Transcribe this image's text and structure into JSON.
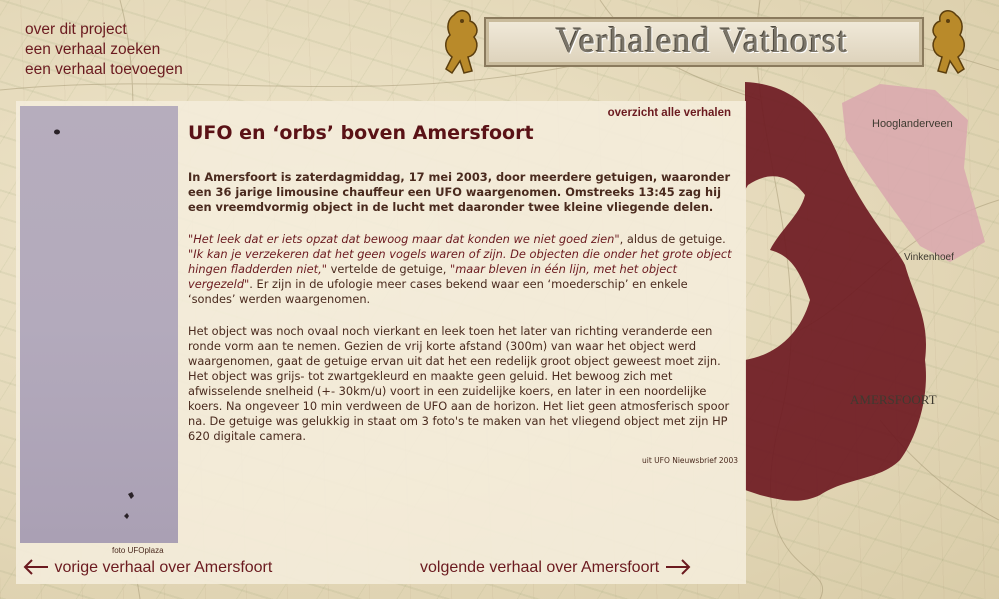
{
  "nav": {
    "items": [
      {
        "label": "over dit project"
      },
      {
        "label": "een verhaal zoeken"
      },
      {
        "label": "een verhaal toevoegen"
      }
    ]
  },
  "banner": {
    "title": "Verhalend Vathorst"
  },
  "map_labels": {
    "hooglanderveen": "Hooglanderveen",
    "vinkenhoef": "Vinkenhoef",
    "amersfoort": "AMERSFOORT"
  },
  "panel": {
    "overview_link": "overzicht alle verhalen",
    "photo_credit": "foto UFOplaza"
  },
  "article": {
    "title": "UFO en ‘orbs’ boven Amersfoort",
    "lead": "In Amersfoort is zaterdagmiddag, 17 mei 2003, door meerdere getuigen, waaronder een 36 jarige limousine chauffeur een UFO waargenomen. Omstreeks 13:45 zag hij een vreemdvormig object in de lucht met daaronder twee kleine vliegende delen.",
    "p2": {
      "q1": "\"Het leek dat er iets opzat dat bewoog maar dat konden we niet goed zien\"",
      "t1": ", aldus de getuige. ",
      "q2": "\"Ik kan je verzekeren dat het geen vogels waren of zijn. De objecten die onder het grote object hingen fladderden niet,\"",
      "t2": " vertelde de getuige, ",
      "q3": "\"maar bleven in één lijn, met het object vergezeld\"",
      "t3": ". Er zijn in de ufologie meer cases bekend waar een ‘moederschip’ en enkele ‘sondes’ werden waargenomen."
    },
    "p3": "Het object was noch ovaal noch vierkant en leek toen het later van richting veranderde een ronde vorm aan te nemen. Gezien de vrij korte afstand (300m) van waar het object werd waargenomen, gaat de getuige ervan uit dat het een redelijk groot object geweest moet zijn. Het object was grijs- tot zwartgekleurd en maakte geen geluid. Het bewoog zich met afwisselende snelheid (+- 30km/u) voort in een zuidelijke koers, en later in een noordelijke koers. Na ongeveer 10 min verdween de UFO aan de horizon. Het liet geen atmosferisch spoor na. De getuige was gelukkig in staat om 3 foto's te maken van het vliegend object met zijn HP 620 digitale camera.",
    "source": "uit UFO Nieuwsbrief 2003"
  },
  "footer": {
    "prev": "vorige verhaal over Amersfoort",
    "next": "volgende verhaal over Amersfoort"
  },
  "colors": {
    "accent": "#6b1a1f",
    "region_dark": "#6e1a22",
    "region_light": "#d9a7ae",
    "panel_bg": "#f4ecda"
  },
  "icons": {
    "prev_arrow": "arrow-left-icon",
    "next_arrow": "arrow-right-icon",
    "lion_left": "lion-crest-icon",
    "lion_right": "lion-crest-icon"
  }
}
